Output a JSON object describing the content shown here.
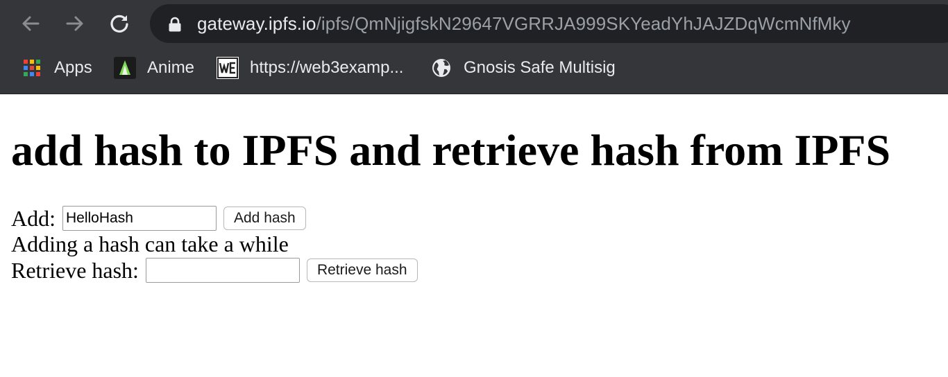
{
  "browser": {
    "url_host": "gateway.ipfs.io",
    "url_path": "/ipfs/QmNjigfskN29647VGRRJA999SKYeadYhJAJZDqWcmNfMky",
    "bookmarks": [
      {
        "label": "Apps",
        "icon": "apps-grid-icon"
      },
      {
        "label": "Anime",
        "icon": "anime-favicon-icon"
      },
      {
        "label": "https://web3examp...",
        "icon": "web3-favicon-icon"
      },
      {
        "label": "Gnosis Safe Multisig",
        "icon": "globe-icon"
      }
    ],
    "colors": {
      "toolbar": "#35363a",
      "omnibox": "#202124",
      "host_text": "#e8eaed",
      "path_text": "#9aa0a6"
    }
  },
  "page": {
    "title": "add hash to IPFS and retrieve hash from IPFS",
    "add_label": "Add:",
    "add_value": "HelloHash",
    "add_button": "Add hash",
    "note": "Adding a hash can take a while",
    "retrieve_label": "Retrieve hash:",
    "retrieve_value": "",
    "retrieve_button": "Retrieve hash"
  }
}
